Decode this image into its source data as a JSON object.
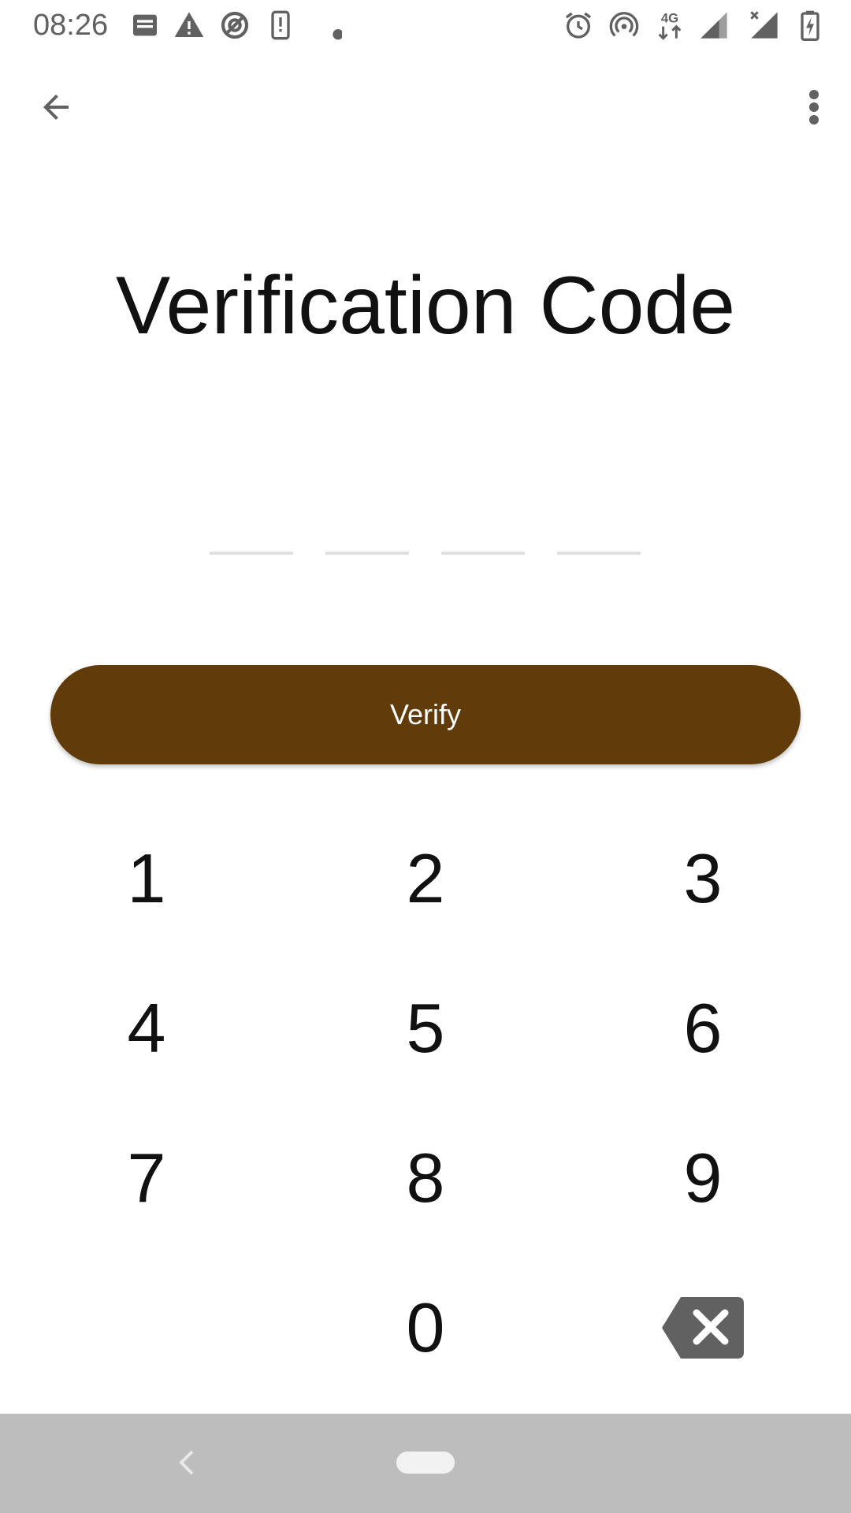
{
  "status_bar": {
    "time": "08:26",
    "left_icons": [
      "message-icon",
      "warning-icon",
      "blocked-sync-icon",
      "device-alert-icon",
      "dot-icon"
    ],
    "right_icons": [
      "alarm-icon",
      "hotspot-icon",
      "network-4g-icon",
      "signal-icon",
      "signal-no-data-icon",
      "battery-charging-icon"
    ],
    "network_label": "4G"
  },
  "app_bar": {
    "back_icon": "arrow-back-icon",
    "menu_icon": "more-vert-icon"
  },
  "title": "Verification Code",
  "code_input": {
    "slots": [
      "",
      "",
      "",
      ""
    ]
  },
  "verify_button": {
    "label": "Verify",
    "color": "#613c0a"
  },
  "keypad": {
    "keys": [
      "1",
      "2",
      "3",
      "4",
      "5",
      "6",
      "7",
      "8",
      "9",
      "0"
    ],
    "backspace_icon": "backspace-icon"
  },
  "nav_bar": {
    "back_icon": "nav-back-icon",
    "home_icon": "home-pill-icon"
  }
}
